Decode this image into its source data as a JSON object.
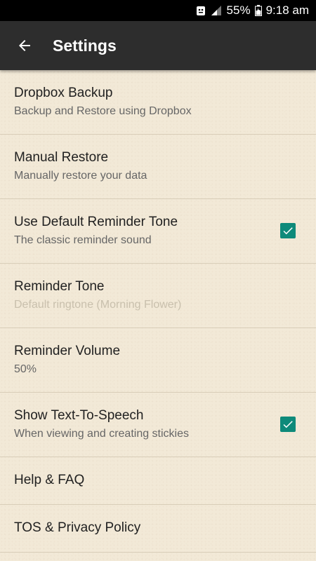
{
  "status_bar": {
    "battery": "55%",
    "time": "9:18 am"
  },
  "app_bar": {
    "title": "Settings"
  },
  "settings": [
    {
      "title": "Dropbox Backup",
      "subtitle": "Backup and Restore using Dropbox"
    },
    {
      "title": "Manual Restore",
      "subtitle": "Manually restore your data"
    },
    {
      "title": "Use Default Reminder Tone",
      "subtitle": "The classic reminder sound",
      "checked": true
    },
    {
      "title": "Reminder Tone",
      "subtitle": "Default ringtone (Morning Flower)",
      "disabled": true
    },
    {
      "title": "Reminder Volume",
      "subtitle": "50%"
    },
    {
      "title": "Show Text-To-Speech",
      "subtitle": "When viewing and creating stickies",
      "checked": true
    },
    {
      "title": "Help & FAQ"
    },
    {
      "title": "TOS & Privacy Policy"
    }
  ],
  "colors": {
    "accent": "#0e8a7a",
    "app_bar": "#2d2d2d",
    "background": "#f2e9d7"
  }
}
